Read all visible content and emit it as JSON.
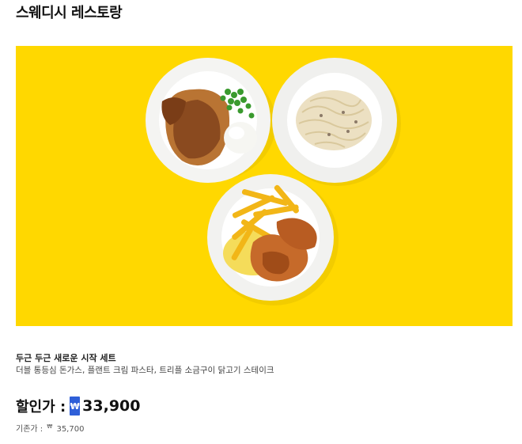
{
  "header": {
    "title": "스웨디시 레스토랑"
  },
  "hero": {
    "background_color": "#FFD800",
    "image_description_icon": "meal-set-photo"
  },
  "product": {
    "name": "두근 두근 새로운 시작 세트",
    "description": "더블 통등심 돈가스, 플랜트 크림 파스타, 트리플 소금구이 닭고기 스테이크"
  },
  "price": {
    "sale_label": "할인가 :",
    "currency_symbol": "₩",
    "sale_amount": "33,900",
    "original_label": "기존가 :",
    "original_currency": "₩",
    "original_amount": "35,700"
  },
  "colors": {
    "accent": "#2f5fd8",
    "hero": "#FFD800"
  }
}
